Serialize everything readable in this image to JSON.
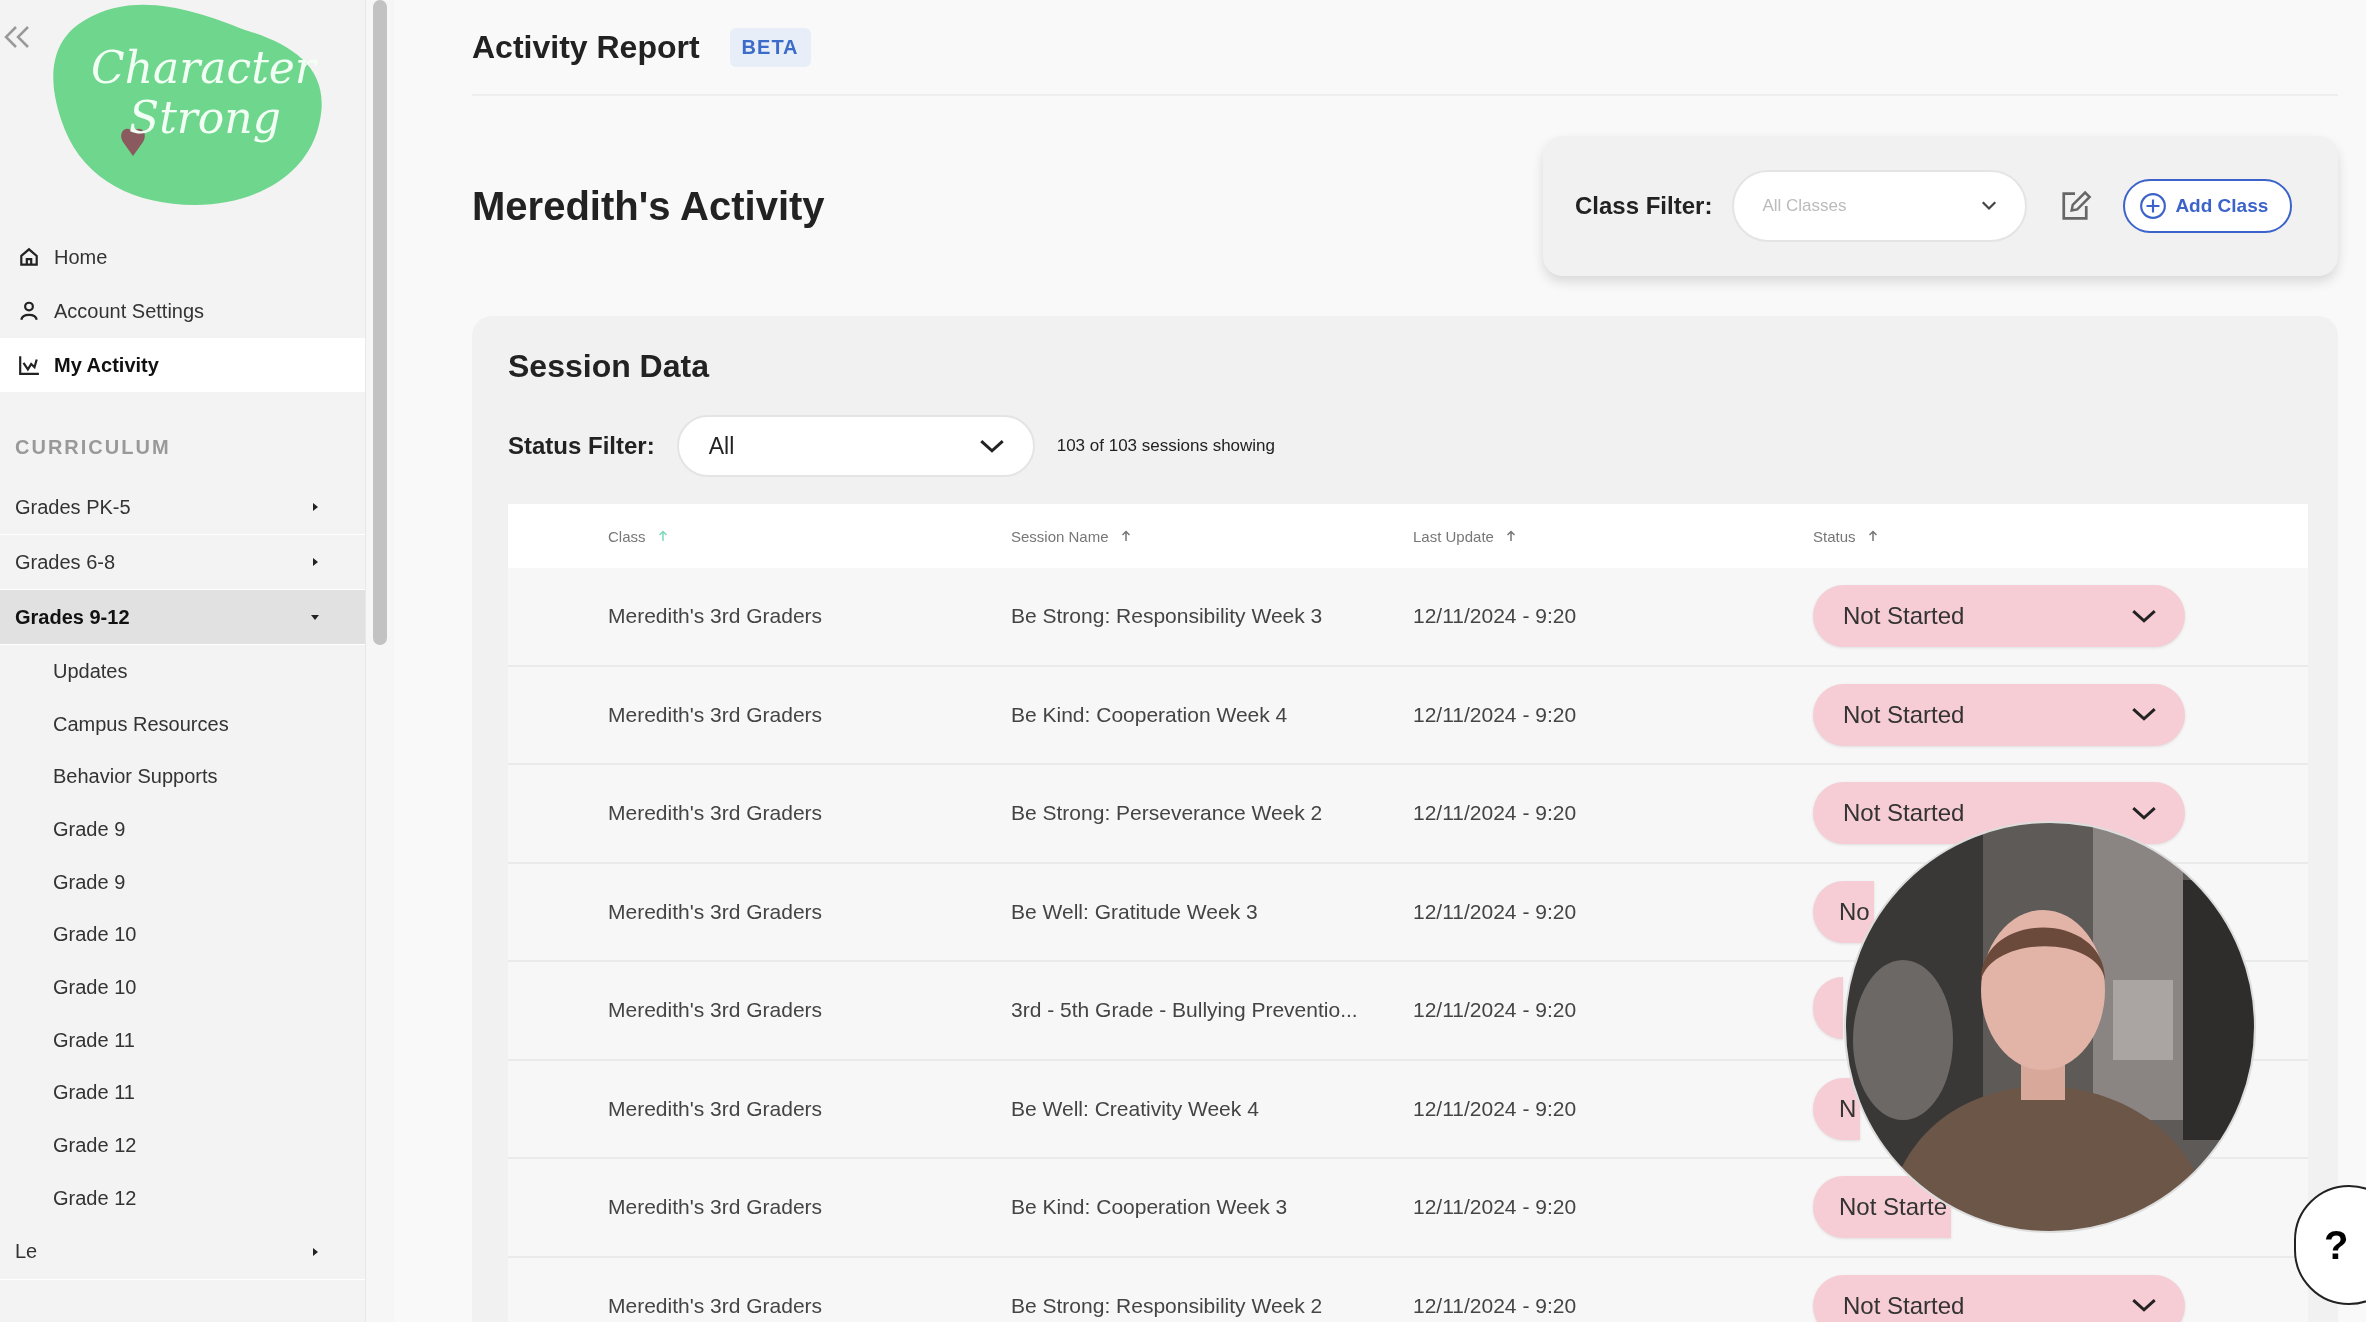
{
  "logo": {
    "line_1": "Character",
    "line_2": "Strong"
  },
  "nav": [
    {
      "label": "Home",
      "selected": false
    },
    {
      "label": "Account Settings",
      "selected": false
    },
    {
      "label": "My Activity",
      "selected": true
    }
  ],
  "curriculum": {
    "heading": "CURRICULUM",
    "groups": [
      {
        "label": "Grades PK-5",
        "expanded": false
      },
      {
        "label": "Grades 6-8",
        "expanded": false
      },
      {
        "label": "Grades 9-12",
        "expanded": true,
        "children": [
          {
            "label": "Updates"
          },
          {
            "label": "Campus Resources"
          },
          {
            "label": "Behavior Supports"
          },
          {
            "label": "Grade 9"
          },
          {
            "label": "Grade 9"
          },
          {
            "label": "Grade 10"
          },
          {
            "label": "Grade 10"
          },
          {
            "label": "Grade 11"
          },
          {
            "label": "Grade 11"
          },
          {
            "label": "Grade 12"
          },
          {
            "label": "Grade 12"
          }
        ]
      },
      {
        "label": "Le",
        "expanded": false
      }
    ]
  },
  "header": {
    "title": "Activity Report",
    "badge": "BETA"
  },
  "page_title": "Meredith's Activity",
  "class_filter": {
    "label": "Class Filter:",
    "placeholder": "All Classes",
    "add_button": "Add Class"
  },
  "session_data": {
    "title": "Session Data",
    "status_filter_label": "Status Filter:",
    "status_filter_value": "All",
    "count": "103 of 103 sessions showing"
  },
  "table": {
    "columns": [
      {
        "label": "Class",
        "sorted": true
      },
      {
        "label": "Session Name",
        "sorted": false
      },
      {
        "label": "Last Update",
        "sorted": false
      },
      {
        "label": "Status",
        "sorted": false
      }
    ],
    "rows": [
      {
        "class": "Meredith's 3rd Graders",
        "session": "Be Strong: Responsibility Week 3",
        "updated": "12/11/2024 - 9:20",
        "status": "Not Started",
        "chevron": true
      },
      {
        "class": "Meredith's 3rd Graders",
        "session": "Be Kind: Cooperation Week 4",
        "updated": "12/11/2024 - 9:20",
        "status": "Not Started",
        "chevron": true
      },
      {
        "class": "Meredith's 3rd Graders",
        "session": "Be Strong: Perseverance Week 2",
        "updated": "12/11/2024 - 9:20",
        "status": "Not Started",
        "chevron": true
      },
      {
        "class": "Meredith's 3rd Graders",
        "session": "Be Well: Gratitude Week 3",
        "updated": "12/11/2024 - 9:20",
        "status": "No",
        "chevron": false
      },
      {
        "class": "Meredith's 3rd Graders",
        "session": "3rd - 5th Grade - Bullying Preventio...",
        "updated": "12/11/2024 - 9:20",
        "chevron": false
      },
      {
        "class": "Meredith's 3rd Graders",
        "session": "Be Well: Creativity Week 4",
        "updated": "12/11/2024 - 9:20",
        "status": "N",
        "chevron": false
      },
      {
        "class": "Meredith's 3rd Graders",
        "session": "Be Kind: Cooperation Week 3",
        "updated": "12/11/2024 - 9:20",
        "status": "Not Starte",
        "chevron": false
      },
      {
        "class": "Meredith's 3rd Graders",
        "session": "Be Strong: Responsibility Week 2",
        "updated": "12/11/2024 - 9:20",
        "status": "Not Started",
        "chevron": true
      }
    ]
  },
  "help": {
    "label": "?"
  }
}
